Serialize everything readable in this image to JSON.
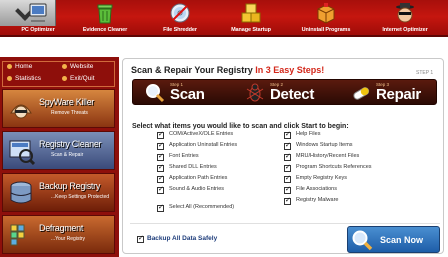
{
  "toolbar": {
    "items": [
      {
        "label": "PC Optimizer",
        "icon": "computer-icon"
      },
      {
        "label": "Evidence Cleaner",
        "icon": "trash-can-icon"
      },
      {
        "label": "File Shredder",
        "icon": "cd-disc-icon"
      },
      {
        "label": "Manage Startup",
        "icon": "boxes-icon"
      },
      {
        "label": "Uninstall Programs",
        "icon": "package-icon"
      },
      {
        "label": "Internet Optimizer",
        "icon": "spy-face-icon"
      }
    ]
  },
  "sidebar": {
    "nav": [
      {
        "label": "Home"
      },
      {
        "label": "Website"
      },
      {
        "label": "Statistics"
      },
      {
        "label": "Exit/Quit"
      }
    ],
    "panels": [
      {
        "title": "SpyWare Killer",
        "subtitle": "Remove Threats",
        "icon": "spyware-icon"
      },
      {
        "title": "Registry Cleaner",
        "subtitle": "Scan & Repair",
        "icon": "registry-icon"
      },
      {
        "title": "Backup Registry",
        "subtitle": "...Keep Settings Protected",
        "icon": "backup-icon"
      },
      {
        "title": "Defragment",
        "subtitle": "...Your Registry",
        "icon": "defrag-icon"
      }
    ]
  },
  "main": {
    "title_prefix": "Scan & Repair Your Registry",
    "title_highlight": "In 3 Easy Steps!",
    "step_tag": "STEP 1",
    "steps": [
      {
        "num": "Step 1",
        "name": "Scan"
      },
      {
        "num": "Step 2",
        "name": "Detect"
      },
      {
        "num": "Step 3",
        "name": "Repair"
      }
    ],
    "instruction": "Select what items you would like to scan and click Start to begin:",
    "options_left": [
      "COM/ActiveX/OLE Entries",
      "Application Uninstall Entries",
      "Font Entries",
      "Shared DLL Entries",
      "Application Path Entries",
      "Sound & Audio Entries"
    ],
    "options_right": [
      "Help Files",
      "Windows Startup Items",
      "MRU/History/Recent Files",
      "Program Shortcuts References",
      "Empty Registry Keys",
      "File Associations",
      "Registry Malware"
    ],
    "select_all": "Select All (Recommended)",
    "backup_label": "Backup All Data Safely",
    "scan_button": "Scan Now"
  },
  "colors": {
    "toolbar_red": "#b8140e",
    "sidebar_red": "#8e0f0b",
    "accent_red": "#d3271a",
    "scan_button_blue": "#2f6fbd"
  }
}
